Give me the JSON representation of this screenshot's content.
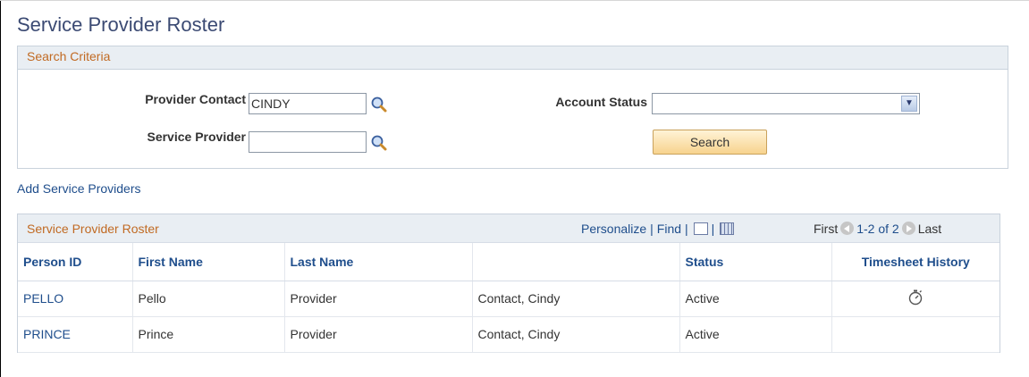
{
  "page": {
    "title": "Service Provider Roster"
  },
  "search": {
    "section_title": "Search Criteria",
    "provider_contact": {
      "label": "Provider Contact",
      "value": "CINDY"
    },
    "service_provider": {
      "label": "Service Provider",
      "value": ""
    },
    "account_status": {
      "label": "Account Status",
      "value": ""
    },
    "search_button": "Search"
  },
  "add_link": "Add Service Providers",
  "roster": {
    "caption": "Service Provider Roster",
    "tools": {
      "personalize": "Personalize",
      "find": "Find"
    },
    "pager": {
      "first": "First",
      "count": "1-2 of 2",
      "last": "Last"
    },
    "columns": [
      "Person ID",
      "First Name",
      "Last Name",
      "",
      "Status",
      "Timesheet History"
    ],
    "rows": [
      {
        "person_id": "PELLO",
        "first_name": "Pello",
        "last_name": "Provider",
        "contact": "Contact, Cindy",
        "status": "Active",
        "history_icon": "stopwatch-icon"
      },
      {
        "person_id": "PRINCE",
        "first_name": "Prince",
        "last_name": "Provider",
        "contact": "Contact, Cindy",
        "status": "Active",
        "history_icon": ""
      }
    ]
  },
  "colors": {
    "title": "#3b4a73",
    "section_header": "#c16a23",
    "link": "#1f4e8c",
    "button": "#f7d38e"
  }
}
